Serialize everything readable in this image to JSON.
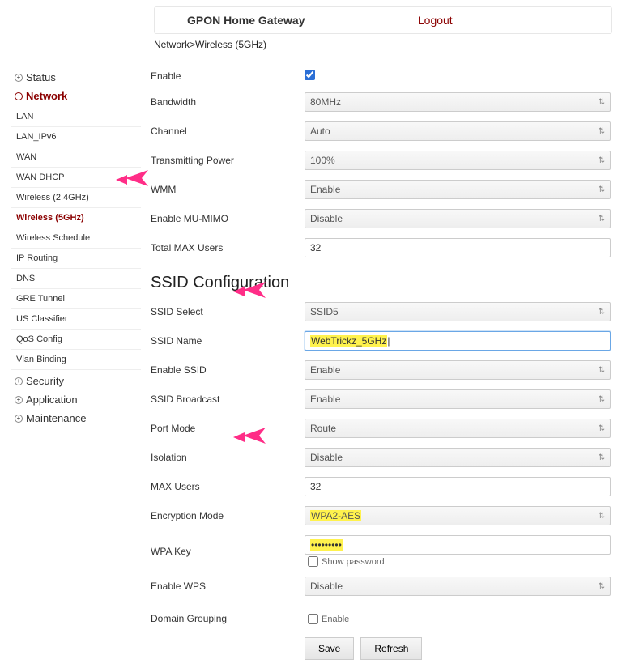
{
  "header": {
    "title": "GPON Home Gateway",
    "logout_label": "Logout"
  },
  "breadcrumb": "Network>Wireless (5GHz)",
  "sidebar": {
    "groups": [
      {
        "label": "Status",
        "expanded": false
      },
      {
        "label": "Network",
        "expanded": true,
        "items": [
          "LAN",
          "LAN_IPv6",
          "WAN",
          "WAN DHCP",
          "Wireless (2.4GHz)",
          "Wireless (5GHz)",
          "Wireless Schedule",
          "IP Routing",
          "DNS",
          "GRE Tunnel",
          "US Classifier",
          "QoS Config",
          "Vlan Binding"
        ],
        "active_index": 5
      },
      {
        "label": "Security",
        "expanded": false
      },
      {
        "label": "Application",
        "expanded": false
      },
      {
        "label": "Maintenance",
        "expanded": false
      }
    ]
  },
  "form": {
    "enable": {
      "label": "Enable",
      "checked": true
    },
    "bandwidth": {
      "label": "Bandwidth",
      "value": "80MHz"
    },
    "channel": {
      "label": "Channel",
      "value": "Auto"
    },
    "tx_power": {
      "label": "Transmitting Power",
      "value": "100%"
    },
    "wmm": {
      "label": "WMM",
      "value": "Enable"
    },
    "mu_mimo": {
      "label": "Enable MU-MIMO",
      "value": "Disable"
    },
    "total_max_users": {
      "label": "Total MAX Users",
      "value": "32"
    }
  },
  "ssid_section": {
    "title": "SSID Configuration",
    "ssid_select": {
      "label": "SSID Select",
      "value": "SSID5"
    },
    "ssid_name": {
      "label": "SSID Name",
      "value": "WebTrickz_5GHz"
    },
    "enable_ssid": {
      "label": "Enable SSID",
      "value": "Enable"
    },
    "ssid_broadcast": {
      "label": "SSID Broadcast",
      "value": "Enable"
    },
    "port_mode": {
      "label": "Port Mode",
      "value": "Route"
    },
    "isolation": {
      "label": "Isolation",
      "value": "Disable"
    },
    "max_users": {
      "label": "MAX Users",
      "value": "32"
    },
    "encryption": {
      "label": "Encryption Mode",
      "value": "WPA2-AES"
    },
    "wpa_key": {
      "label": "WPA Key",
      "value": "•••••••••",
      "show_label": "Show password"
    },
    "enable_wps": {
      "label": "Enable WPS",
      "value": "Disable"
    },
    "domain_grouping": {
      "label": "Domain Grouping",
      "check_label": "Enable"
    }
  },
  "buttons": {
    "save": "Save",
    "refresh": "Refresh"
  }
}
